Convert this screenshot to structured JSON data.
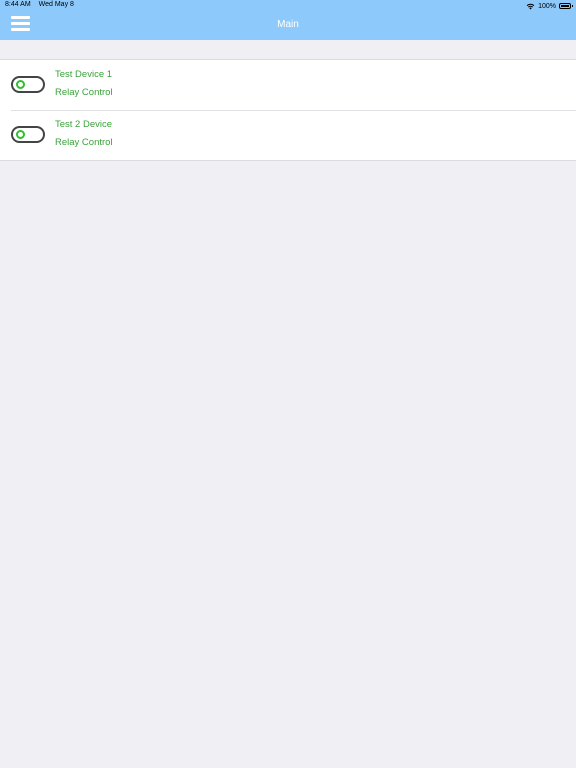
{
  "status_bar": {
    "time": "8:44 AM",
    "date": "Wed May 8",
    "battery_percent": "100%",
    "battery_level": 1.0
  },
  "header": {
    "title": "Main",
    "background_color": "#8ec9fb",
    "menu_icon": "hamburger-menu-icon"
  },
  "devices": [
    {
      "name": "Test Device 1",
      "subtitle": "Relay Control"
    },
    {
      "name": "Test 2 Device",
      "subtitle": "Relay Control"
    }
  ],
  "colors": {
    "device_text": "#3aa33a",
    "toggle_knob": "#2fbf2f",
    "page_background": "#efeff4"
  }
}
